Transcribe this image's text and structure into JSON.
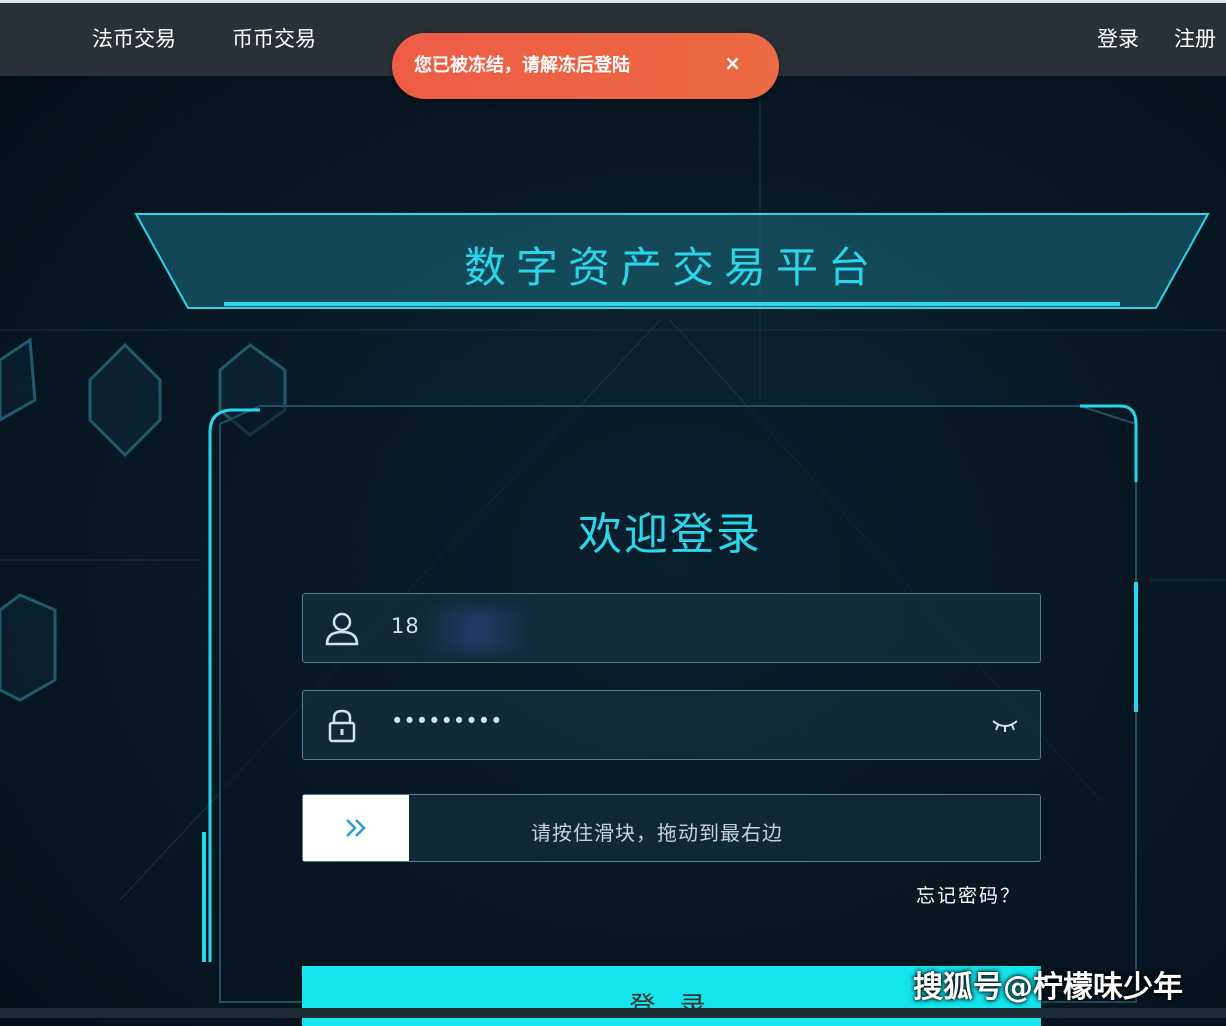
{
  "nav": {
    "left_links": [
      "法币交易",
      "币币交易"
    ],
    "right_links": [
      "登录",
      "注册"
    ]
  },
  "toast": {
    "message": "您已被冻结，请解冻后登陆",
    "close_symbol": "×",
    "color": "#ee5c46"
  },
  "banner": {
    "title": "数字资产交易平台"
  },
  "login": {
    "heading": "欢迎登录",
    "username_value": "18",
    "password_value": "•••••••••",
    "slider_hint": "请按住滑块，拖动到最右边",
    "forgot_link": "忘记密码？",
    "submit_label": "登 录"
  },
  "watermark": "搜狐号@柠檬味少年",
  "colors": {
    "accent": "#2ad6ea",
    "button": "#14e4ec",
    "topbar": "#2a3037"
  }
}
